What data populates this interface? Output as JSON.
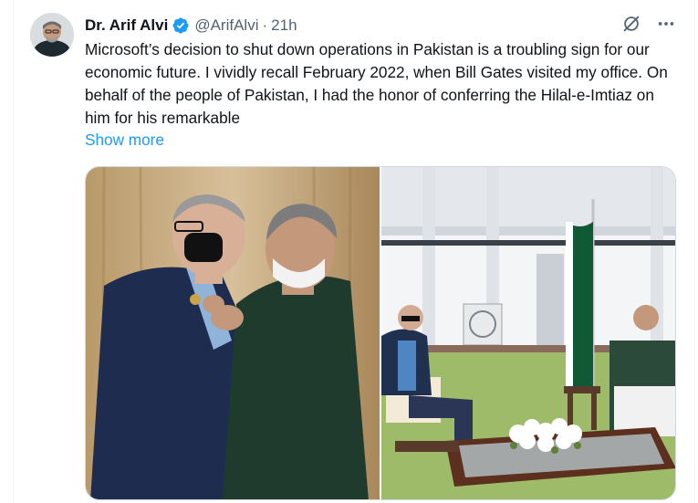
{
  "tweet": {
    "author_name": "Dr. Arif Alvi",
    "handle": "@ArifAlvi",
    "separator": "·",
    "time": "21h",
    "text": "Microsoft’s decision to shut down operations in Pakistan is a troubling sign for our economic future. I vividly recall February 2022, when Bill Gates visited my office. On behalf of the people of Pakistan, I had the honor of conferring the Hilal-e-Imtiaz on him for his remarkable",
    "show_more": "Show more"
  },
  "icons": {
    "verified": "verified-badge-icon",
    "grok": "grok-icon",
    "more": "more-icon"
  },
  "colors": {
    "link": "#1d9bf0",
    "verified": "#1d9bf0",
    "secondary_text": "#536471"
  }
}
